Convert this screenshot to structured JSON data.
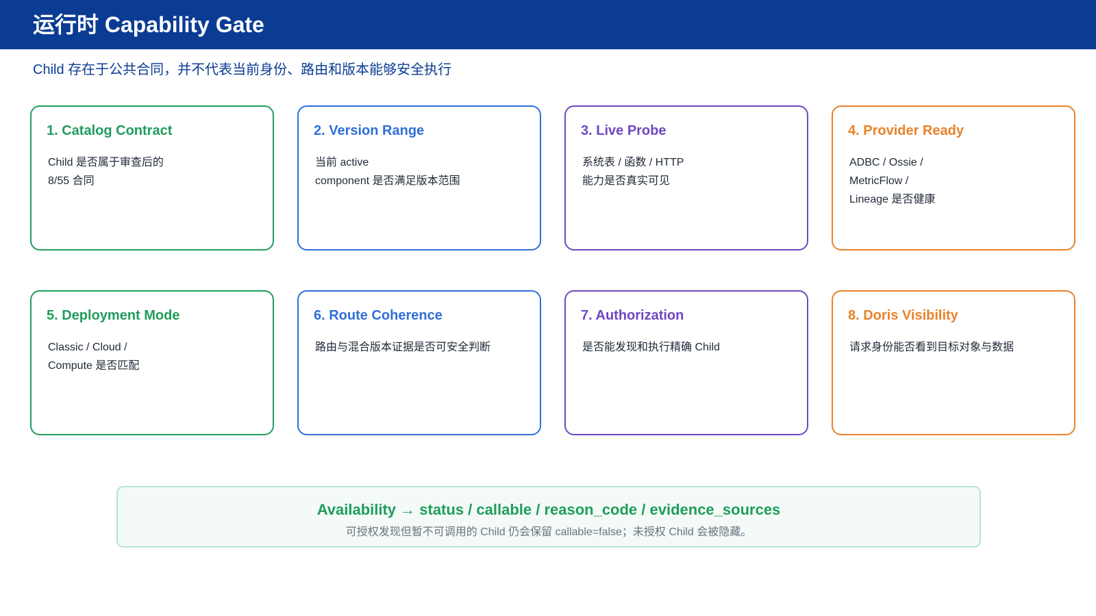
{
  "header": {
    "title": "运行时 Capability Gate",
    "subtitle": "Child 存在于公共合同，并不代表当前身份、路由和版本能够安全执行"
  },
  "colors": {
    "header_bg": "#0b3c93",
    "green": "#1f9d5c",
    "blue": "#2f6fd8",
    "purple": "#7046c2",
    "orange": "#e8822a"
  },
  "gates": [
    {
      "title": "1. Catalog Contract",
      "body": "Child 是否属于审查后的\n8/55 合同",
      "color": "green"
    },
    {
      "title": "2. Version Range",
      "body": "当前 active\ncomponent 是否满足版本范围",
      "color": "blue"
    },
    {
      "title": "3. Live Probe",
      "body": "系统表 / 函数 / HTTP\n能力是否真实可见",
      "color": "purple"
    },
    {
      "title": "4. Provider Ready",
      "body": "ADBC / Ossie /\nMetricFlow /\nLineage 是否健康",
      "color": "orange"
    },
    {
      "title": "5. Deployment Mode",
      "body": "Classic / Cloud /\nCompute 是否匹配",
      "color": "green"
    },
    {
      "title": "6. Route Coherence",
      "body": "路由与混合版本证据是否可安全判断",
      "color": "blue"
    },
    {
      "title": "7. Authorization",
      "body": "是否能发现和执行精确 Child",
      "color": "purple"
    },
    {
      "title": "8. Doris Visibility",
      "body": "请求身份能否看到目标对象与数据",
      "color": "orange"
    }
  ],
  "footer": {
    "title": "Availability → status / callable / reason_code / evidence_sources",
    "note": "可授权发现但暂不可调用的 Child 仍会保留 callable=false；未授权 Child 会被隐藏。"
  }
}
